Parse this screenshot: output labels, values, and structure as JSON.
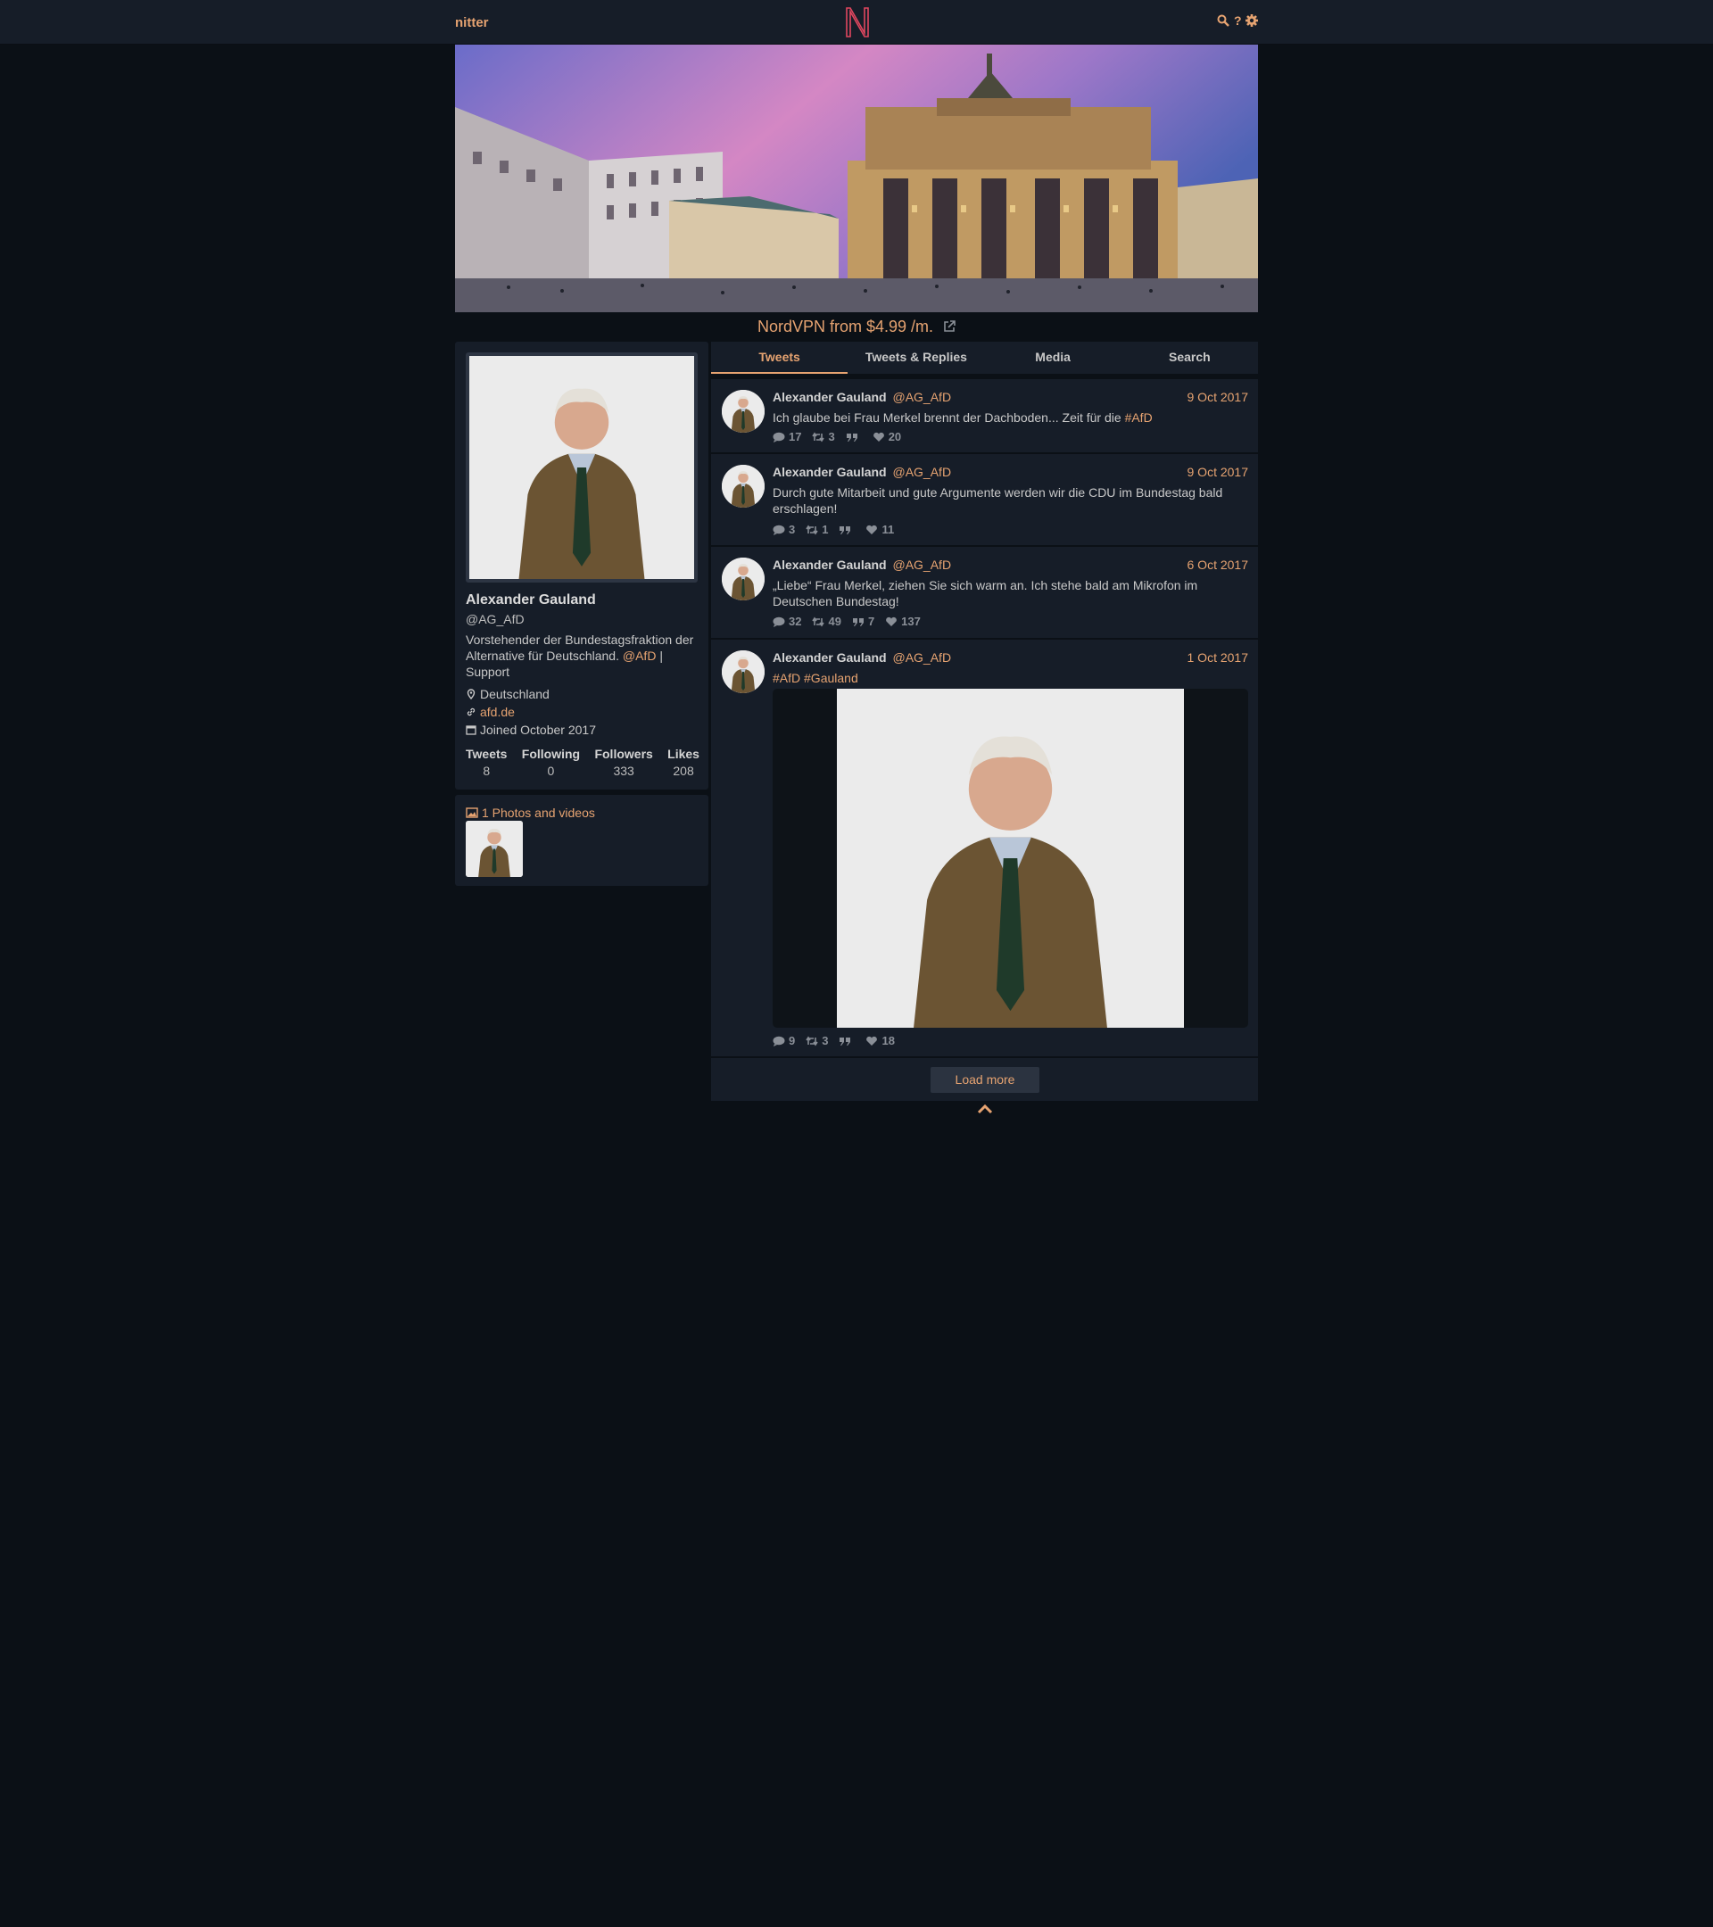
{
  "nav": {
    "brand": "nitter",
    "accent": "#e6a371",
    "icons": [
      "search-icon",
      "help-icon",
      "gear-icon"
    ],
    "help_label": "?"
  },
  "ad": {
    "text": "NordVPN from $4.99 /m."
  },
  "profile": {
    "name": "Alexander Gauland",
    "handle": "@AG_AfD",
    "bio_text": "Vorstehender der Bundestagsfraktion der Alternative für Deutschland.",
    "bio_mention": "@AfD",
    "bio_suffix": "| Support",
    "location": "Deutschland",
    "website": "afd.de",
    "joined": "Joined October 2017",
    "stats": [
      {
        "label": "Tweets",
        "value": "8"
      },
      {
        "label": "Following",
        "value": "0"
      },
      {
        "label": "Followers",
        "value": "333"
      },
      {
        "label": "Likes",
        "value": "208"
      }
    ]
  },
  "media": {
    "title": "1 Photos and videos"
  },
  "tabs": [
    "Tweets",
    "Tweets & Replies",
    "Media",
    "Search"
  ],
  "tweets": [
    {
      "name": "Alexander Gauland",
      "handle": "@AG_AfD",
      "date": "9 Oct 2017",
      "text": "Ich glaube bei Frau Merkel brennt der Dachboden... Zeit für die",
      "tags": "#AfD",
      "replies": "17",
      "retweets": "3",
      "quotes": "",
      "likes": "20"
    },
    {
      "name": "Alexander Gauland",
      "handle": "@AG_AfD",
      "date": "9 Oct 2017",
      "text": "Durch gute Mitarbeit und gute Argumente werden wir die CDU im Bundestag bald erschlagen!",
      "tags": "",
      "replies": "3",
      "retweets": "1",
      "quotes": "",
      "likes": "11"
    },
    {
      "name": "Alexander Gauland",
      "handle": "@AG_AfD",
      "date": "6 Oct 2017",
      "text": "„Liebe“ Frau Merkel, ziehen Sie sich warm an. Ich stehe bald am Mikrofon im Deutschen Bundestag!",
      "tags": "",
      "replies": "32",
      "retweets": "49",
      "quotes": "7",
      "likes": "137"
    },
    {
      "name": "Alexander Gauland",
      "handle": "@AG_AfD",
      "date": "1 Oct 2017",
      "text": "",
      "tags": "#AfD #Gauland",
      "replies": "9",
      "retweets": "3",
      "quotes": "",
      "likes": "18"
    }
  ],
  "load_more": "Load more"
}
